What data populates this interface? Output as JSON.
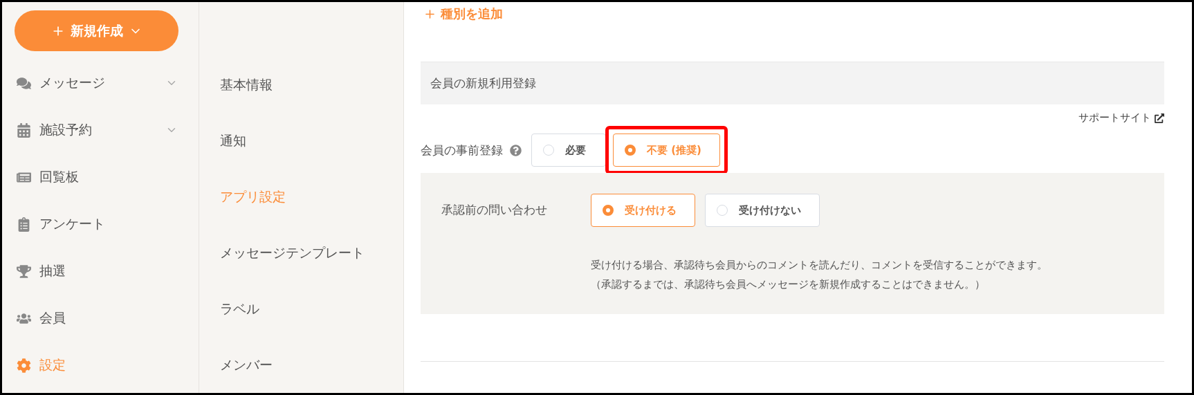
{
  "new_button": {
    "label": "新規作成"
  },
  "sidebar": {
    "items": [
      {
        "label": "メッセージ",
        "expandable": true,
        "selected": false
      },
      {
        "label": "施設予約",
        "expandable": true,
        "selected": false
      },
      {
        "label": "回覧板",
        "expandable": false,
        "selected": false
      },
      {
        "label": "アンケート",
        "expandable": false,
        "selected": false
      },
      {
        "label": "抽選",
        "expandable": false,
        "selected": false
      },
      {
        "label": "会員",
        "expandable": false,
        "selected": false
      },
      {
        "label": "設定",
        "expandable": false,
        "selected": true
      }
    ]
  },
  "settings_nav": {
    "items": [
      {
        "label": "基本情報",
        "selected": false
      },
      {
        "label": "通知",
        "selected": false
      },
      {
        "label": "アプリ設定",
        "selected": true
      },
      {
        "label": "メッセージテンプレート",
        "selected": false
      },
      {
        "label": "ラベル",
        "selected": false
      },
      {
        "label": "メンバー",
        "selected": false
      }
    ]
  },
  "main": {
    "add_link": "種別を追加",
    "section_title": "会員の新規利用登録",
    "support_link": "サポートサイト",
    "pre_registration": {
      "label": "会員の事前登録",
      "options": [
        {
          "label": "必要",
          "selected": false,
          "highlighted": false
        },
        {
          "label": "不要 (推奨)",
          "selected": true,
          "highlighted": true
        }
      ]
    },
    "inquiry": {
      "label": "承認前の問い合わせ",
      "options": [
        {
          "label": "受け付ける",
          "selected": true
        },
        {
          "label": "受け付けない",
          "selected": false
        }
      ],
      "description": [
        "受け付ける場合、承認待ち会員からのコメントを読んだり、コメントを受信することができます。",
        "（承認するまでは、承認待ち会員へメッセージを新規作成することはできません。）"
      ]
    }
  }
}
